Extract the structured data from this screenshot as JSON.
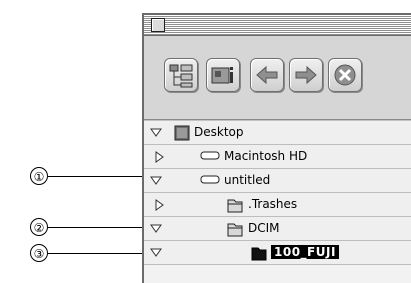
{
  "callouts": [
    {
      "label": "①"
    },
    {
      "label": "②"
    },
    {
      "label": "③"
    }
  ],
  "toolbar": {
    "buttons": [
      {
        "icon": "tree-view-icon"
      },
      {
        "icon": "info-icon"
      },
      {
        "icon": "back-arrow-icon"
      },
      {
        "icon": "forward-arrow-icon"
      },
      {
        "icon": "stop-icon"
      }
    ]
  },
  "list": {
    "items": [
      {
        "label": "Desktop",
        "expanded": true
      },
      {
        "label": "Macintosh HD",
        "expanded": false
      },
      {
        "label": "untitled",
        "expanded": true
      },
      {
        "label": ".Trashes",
        "expanded": false
      },
      {
        "label": "DCIM",
        "expanded": true
      },
      {
        "label": "100_FUJI",
        "expanded": true,
        "selected": true
      }
    ]
  }
}
